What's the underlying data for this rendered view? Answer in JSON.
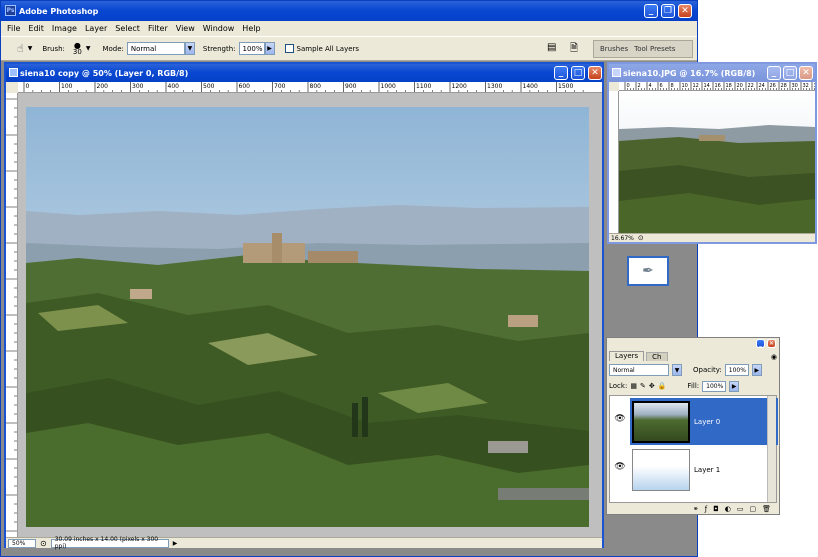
{
  "app": {
    "title": "Adobe Photoshop"
  },
  "menu": [
    "File",
    "Edit",
    "Image",
    "Layer",
    "Select",
    "Filter",
    "View",
    "Window",
    "Help"
  ],
  "options_bar": {
    "brush_label": "Brush:",
    "brush_size": "30",
    "mode_label": "Mode:",
    "mode_value": "Normal",
    "strength_label": "Strength:",
    "strength_value": "100%",
    "sample_label": "Sample All Layers",
    "palette_tabs": [
      "Brushes",
      "Tool Presets"
    ]
  },
  "main_doc": {
    "title": "siena10 copy @ 50% (Layer 0, RGB/8)",
    "ruler_labels": [
      "0",
      "100",
      "200",
      "300",
      "400",
      "500",
      "600",
      "700",
      "800",
      "900",
      "1000",
      "1100",
      "1200",
      "1300",
      "1400",
      "1500"
    ],
    "zoom": "50%",
    "status_text": "30.09 inches x 14.00 (pixels x 300 ppi)"
  },
  "second_doc": {
    "title": "siena10.JPG @ 16.7% (RGB/8)",
    "ruler_labels": [
      "0",
      "2",
      "4",
      "6",
      "8",
      "10",
      "12",
      "14",
      "16",
      "18",
      "20",
      "22",
      "24",
      "26",
      "28",
      "30",
      "32",
      "34"
    ],
    "zoom": "16.67%"
  },
  "layers_palette": {
    "tabs": [
      "Layers",
      "Ch"
    ],
    "blend_mode": "Normal",
    "opacity_label": "Opacity:",
    "opacity_value": "100%",
    "lock_label": "Lock:",
    "fill_label": "Fill:",
    "fill_value": "100%",
    "layers": [
      {
        "name": "Layer 0",
        "selected": true
      },
      {
        "name": "Layer 1",
        "selected": false
      }
    ]
  },
  "colors": {
    "xp_blue": "#0a48d2",
    "chrome": "#ece9d8",
    "workspace": "#8a8a8a",
    "selection": "#3169c6"
  }
}
